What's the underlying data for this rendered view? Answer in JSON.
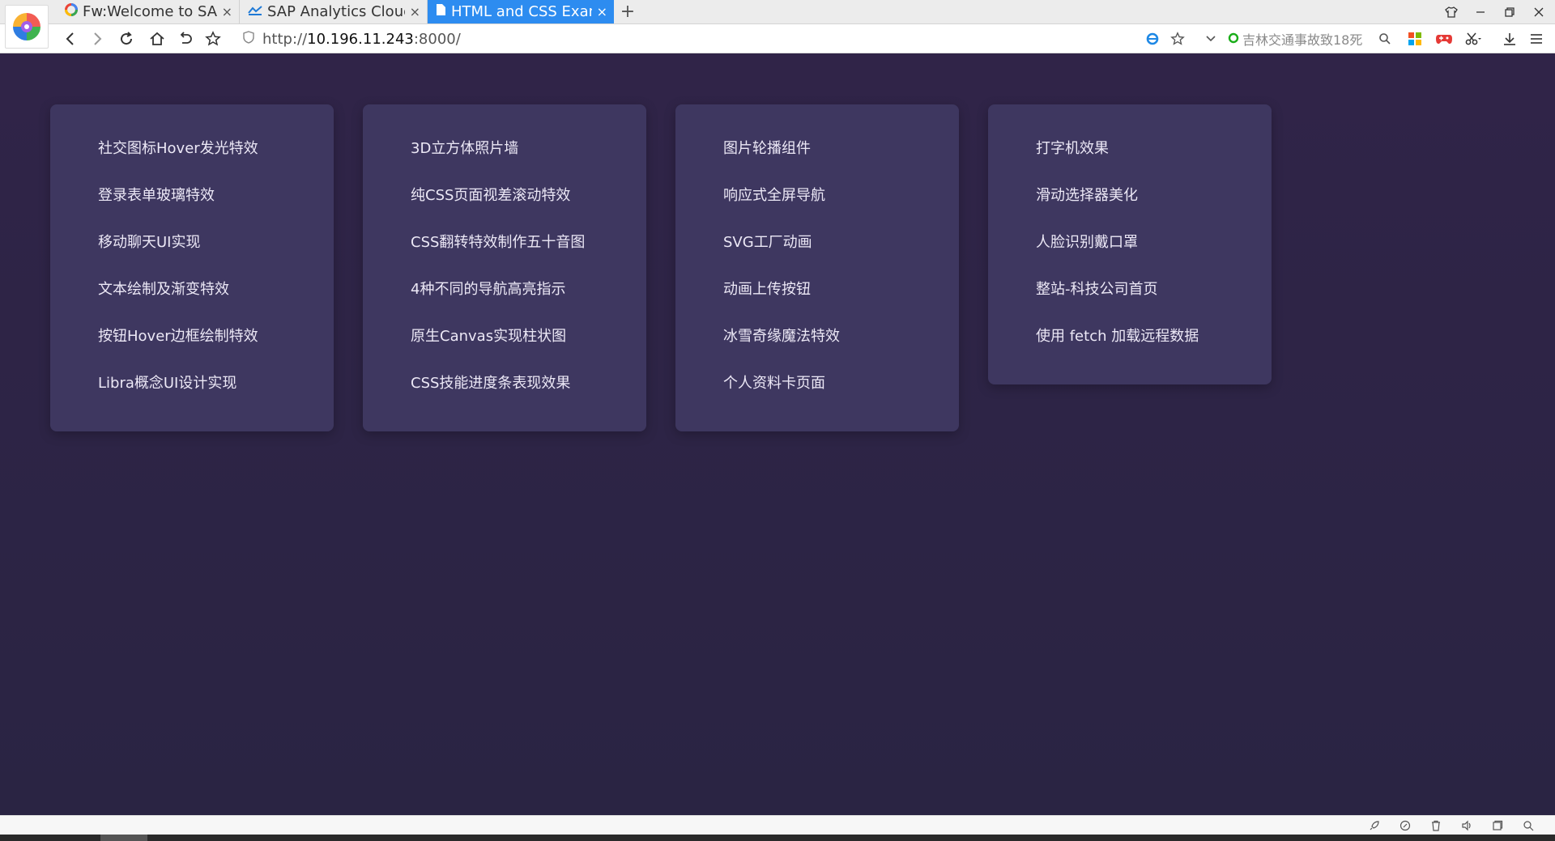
{
  "browser": {
    "tabs": [
      {
        "title": "Fw:Welcome to SAP",
        "icon": "google-icon",
        "active": false
      },
      {
        "title": "SAP Analytics Cloud",
        "icon": "sap-icon",
        "active": false
      },
      {
        "title": "HTML and CSS Exam",
        "icon": "page-icon",
        "active": true
      }
    ],
    "new_tab_label": "+",
    "tab_close_label": "×",
    "url_prefix": "http://",
    "url_host": "10.196.11.243",
    "url_suffix": ":8000/",
    "search_hint": "吉林交通事故致18死",
    "accent_color": "#2d8cf0"
  },
  "page": {
    "background_color": "#2e2445",
    "card_color": "#3e3760",
    "columns": [
      {
        "items": [
          "社交图标Hover发光特效",
          "登录表单玻璃特效",
          "移动聊天UI实现",
          "文本绘制及渐变特效",
          "按钮Hover边框绘制特效",
          "Libra概念UI设计实现"
        ]
      },
      {
        "items": [
          "3D立方体照片墙",
          "纯CSS页面视差滚动特效",
          "CSS翻转特效制作五十音图",
          "4种不同的导航高亮指示",
          "原生Canvas实现柱状图",
          "CSS技能进度条表现效果"
        ]
      },
      {
        "items": [
          "图片轮播组件",
          "响应式全屏导航",
          "SVG工厂动画",
          "动画上传按钮",
          "冰雪奇缘魔法特效",
          "个人资料卡页面"
        ]
      },
      {
        "items": [
          "打字机效果",
          "滑动选择器美化",
          "人脸识别戴口罩",
          "整站-科技公司首页",
          "使用 fetch 加载远程数据"
        ]
      }
    ]
  }
}
